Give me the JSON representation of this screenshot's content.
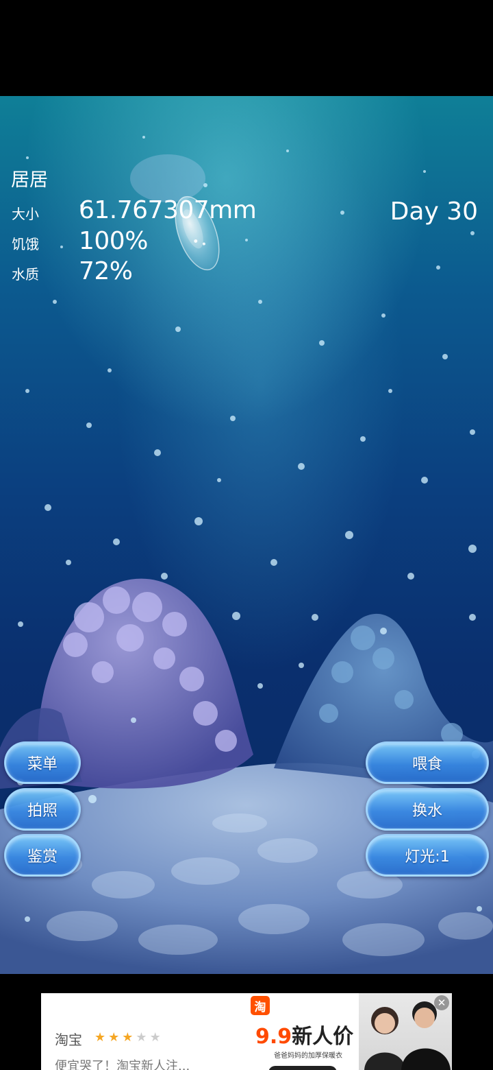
{
  "pet": {
    "name": "居居",
    "day": "Day 30",
    "stats": [
      {
        "label": "大小",
        "value": "61.767307mm"
      },
      {
        "label": "饥饿",
        "value": "100%"
      },
      {
        "label": "水质",
        "value": "72%"
      }
    ]
  },
  "buttons": {
    "menu": "菜单",
    "photo": "拍照",
    "appreciate": "鉴赏",
    "feed": "喂食",
    "change_water": "换水",
    "light": "灯光:1"
  },
  "ad": {
    "brand_logo": "淘",
    "script_title": "淘宝",
    "rating": 3,
    "rating_max": 5,
    "script_subtitle": "便宜哭了！淘宝新人注...",
    "price_number": "9.9",
    "price_text": "新人价",
    "description": "爸爸妈妈的加厚保暖衣",
    "close_icon": "close-icon"
  },
  "colors": {
    "button_fill": "#3b87e1",
    "button_border": "#aadcff",
    "water_top": "#0f7f97",
    "water_bottom": "#0a2a63",
    "ad_accent": "#ff4a00"
  }
}
